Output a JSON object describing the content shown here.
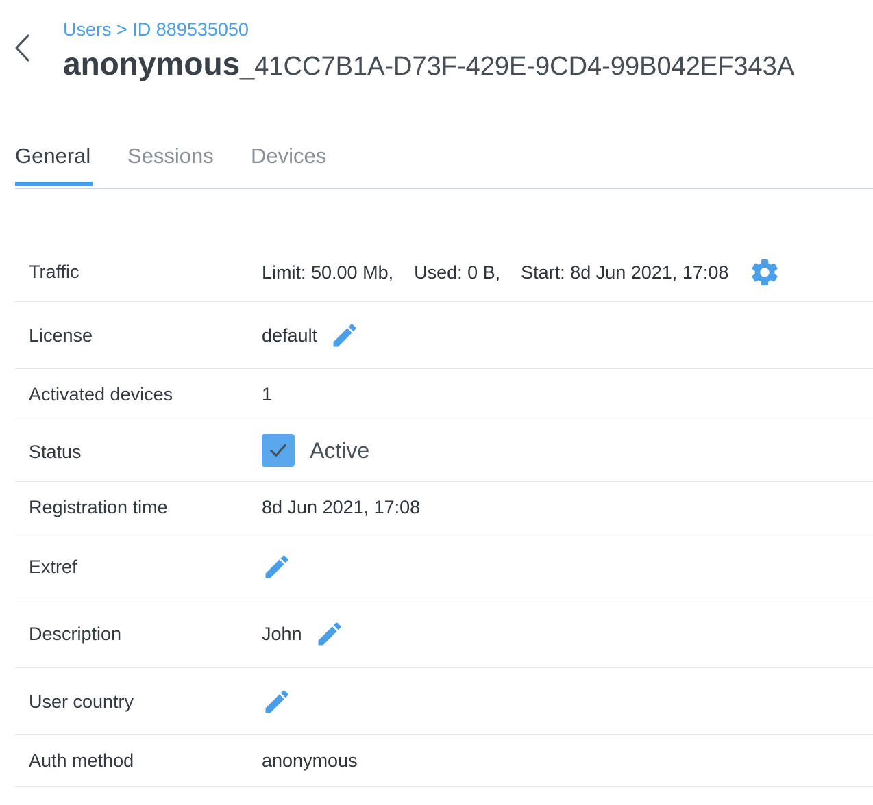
{
  "header": {
    "breadcrumb": "Users > ID 889535050",
    "title_prefix": "anonymous",
    "title_suffix": "_41CC7B1A-D73F-429E-9CD4-99B042EF343A",
    "back_icon": "chevron-left-icon"
  },
  "tabs": [
    {
      "label": "General",
      "active": true
    },
    {
      "label": "Sessions",
      "active": false
    },
    {
      "label": "Devices",
      "active": false
    }
  ],
  "accent_color": "#4a9fe8",
  "fields": {
    "traffic": {
      "label": "Traffic",
      "limit": "Limit: 50.00 Mb,",
      "used": "Used: 0 B,",
      "start": "Start: 8d Jun 2021, 17:08",
      "icon": "gear-icon"
    },
    "license": {
      "label": "License",
      "value": "default",
      "icon": "pencil-icon"
    },
    "activated_devices": {
      "label": "Activated devices",
      "value": "1"
    },
    "status": {
      "label": "Status",
      "value": "Active",
      "checked": true
    },
    "registration_time": {
      "label": "Registration time",
      "value": "8d Jun 2021, 17:08"
    },
    "extref": {
      "label": "Extref",
      "value": "",
      "icon": "pencil-icon"
    },
    "description": {
      "label": "Description",
      "value": "John",
      "icon": "pencil-icon"
    },
    "user_country": {
      "label": "User country",
      "value": "",
      "icon": "pencil-icon"
    },
    "auth_method": {
      "label": "Auth method",
      "value": "anonymous"
    }
  }
}
